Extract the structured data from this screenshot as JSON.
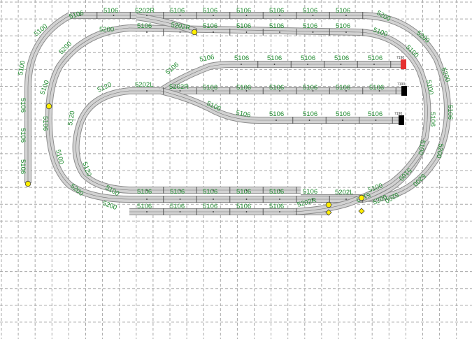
{
  "labels": {
    "straight": "5106",
    "curve_inner": "5100",
    "curve_outer": "5200",
    "curve_small": "5120",
    "turnout_right": "5202R",
    "turnout_left": "5202L",
    "buffer": "7190"
  },
  "colors": {
    "background": "#ffffff",
    "grid": "#a8a8a8",
    "rail_edge": "#8c8c8c",
    "rail_fill": "#d2d2d2",
    "label": "#1e8a2e",
    "sensor": "#ffee00",
    "buffer_stop": "#000000",
    "buffer_stop_highlight": "#e53030"
  },
  "icons": {
    "sensor": "yellow-circle-contact",
    "buffer": "buffer-stop-block"
  }
}
